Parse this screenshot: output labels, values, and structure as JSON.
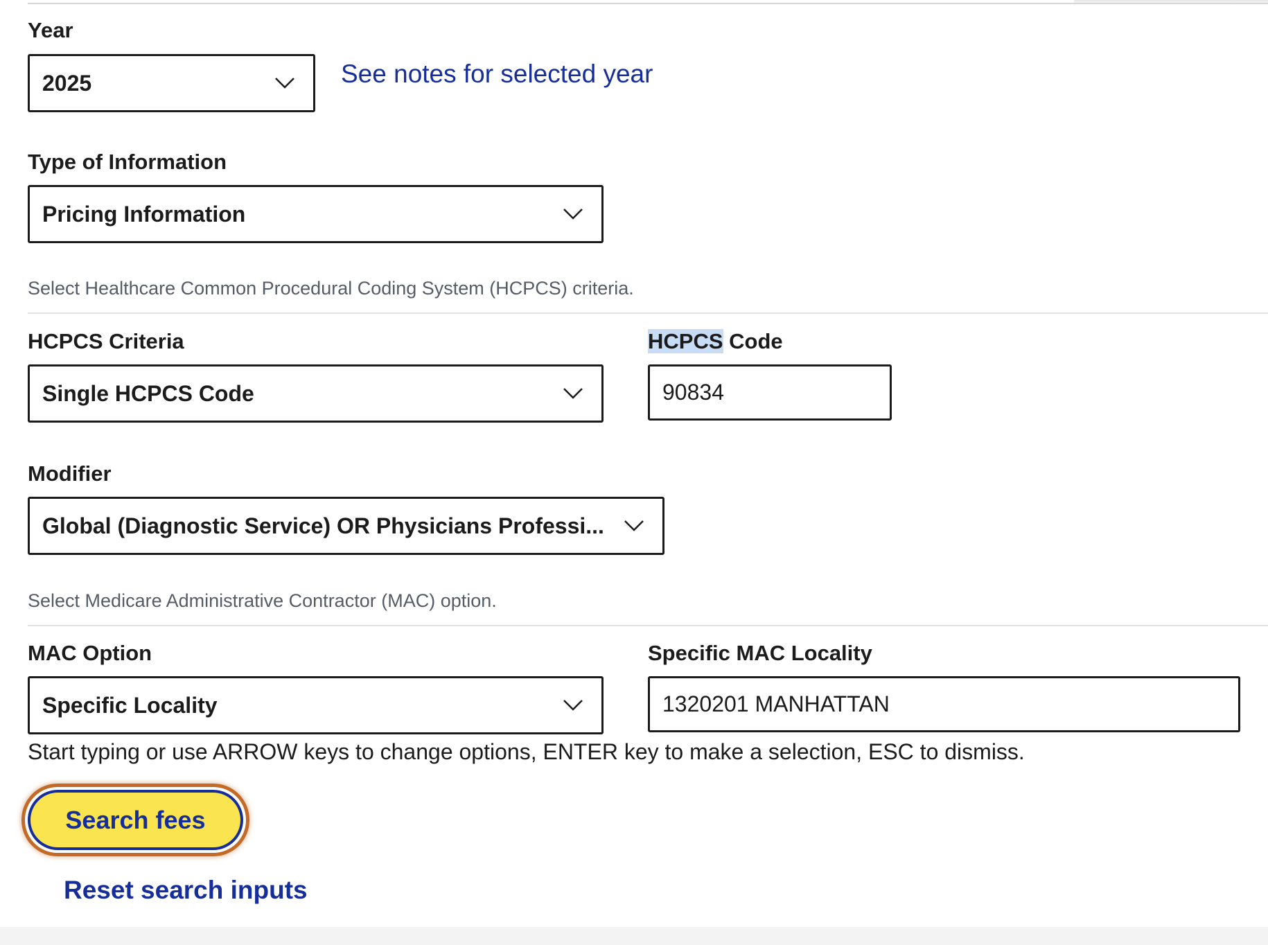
{
  "year": {
    "label": "Year",
    "value": "2025",
    "notes_link": "See notes for selected year"
  },
  "type_of_information": {
    "label": "Type of Information",
    "value": "Pricing Information"
  },
  "hcpcs_section": {
    "helper": "Select Healthcare Common Procedural Coding System (HCPCS) criteria.",
    "criteria_label": "HCPCS Criteria",
    "criteria_value": "Single HCPCS Code",
    "code_label_highlight": "HCPCS",
    "code_label_rest": " Code",
    "code_value": "90834"
  },
  "modifier": {
    "label": "Modifier",
    "value": "Global (Diagnostic Service) OR Physicians Professi..."
  },
  "mac_section": {
    "helper": "Select Medicare Administrative Contractor (MAC) option.",
    "option_label": "MAC Option",
    "option_value": "Specific Locality",
    "locality_label": "Specific MAC Locality",
    "locality_value": "1320201 MANHATTAN",
    "hint": "Start typing or use ARROW keys to change options, ENTER key to make a selection, ESC to dismiss."
  },
  "actions": {
    "search_label": "Search fees",
    "reset_label": "Reset search inputs"
  },
  "icons": {
    "chevron": "chevron-down-icon"
  },
  "colors": {
    "link": "#162e9a",
    "button_bg": "#fae450",
    "focus_ring": "#c26a27",
    "border": "#1b1b1b"
  }
}
